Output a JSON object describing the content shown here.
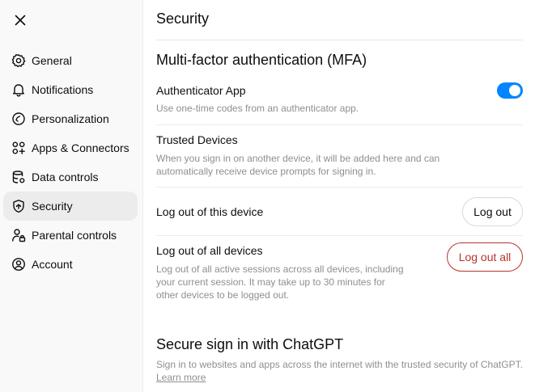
{
  "sidebar": {
    "close_icon": "close-icon",
    "items": [
      {
        "label": "General",
        "icon": "gear-icon"
      },
      {
        "label": "Notifications",
        "icon": "bell-icon"
      },
      {
        "label": "Personalization",
        "icon": "personalization-icon"
      },
      {
        "label": "Apps & Connectors",
        "icon": "apps-icon"
      },
      {
        "label": "Data controls",
        "icon": "database-icon"
      },
      {
        "label": "Security",
        "icon": "shield-icon",
        "active": true
      },
      {
        "label": "Parental controls",
        "icon": "person-lock-icon"
      },
      {
        "label": "Account",
        "icon": "account-icon"
      }
    ]
  },
  "main": {
    "title": "Security",
    "mfa": {
      "heading": "Multi-factor authentication (MFA)",
      "authenticator": {
        "title": "Authenticator App",
        "description": "Use one-time codes from an authenticator app.",
        "enabled": true
      },
      "trusted_devices": {
        "title": "Trusted Devices",
        "description_line1": "When you sign in on another device, it will be added here and can",
        "description_line2": "automatically receive device prompts for signing in."
      }
    },
    "logout_device": {
      "title": "Log out of this device",
      "button": "Log out"
    },
    "logout_all": {
      "title": "Log out of all devices",
      "description_line1": "Log out of all active sessions across all devices, including",
      "description_line2": "your current session. It may take up to 30 minutes for",
      "description_line3": "other devices to be logged out.",
      "button": "Log out all"
    },
    "secure_signin": {
      "heading": "Secure sign in with ChatGPT",
      "description": "Sign in to websites and apps across the internet with the trusted security of ChatGPT.",
      "link": "Learn more"
    }
  },
  "colors": {
    "toggle_on": "#0285ff",
    "danger": "#b8342a",
    "sidebar_bg": "#f9f9f9",
    "active_item_bg": "#ececec"
  }
}
